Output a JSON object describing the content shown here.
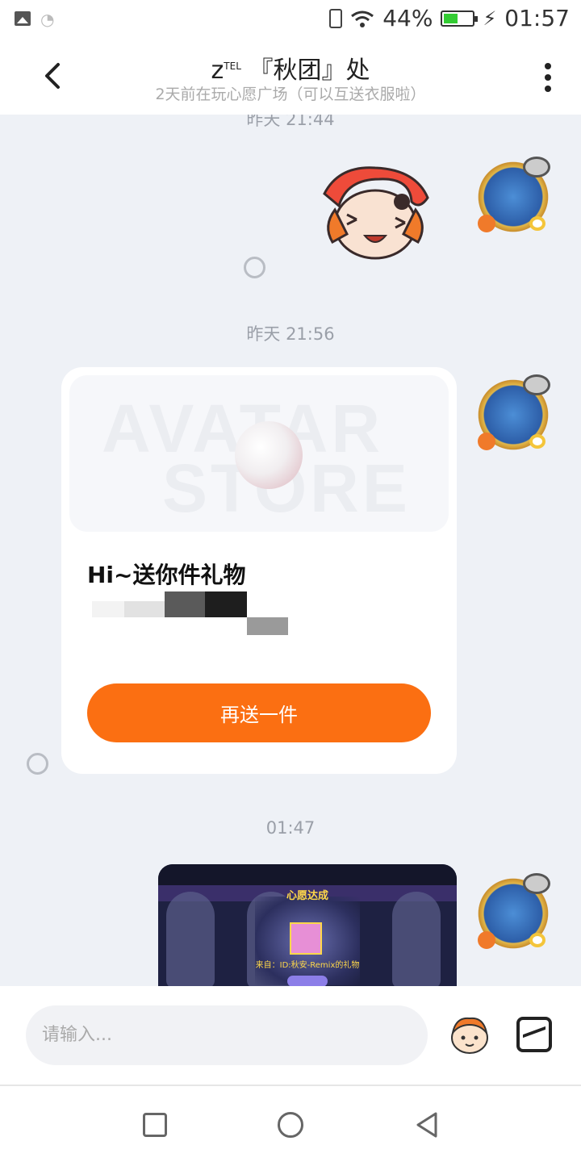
{
  "status_bar": {
    "battery": "44%",
    "battery_level": 0.44,
    "time": "01:57"
  },
  "header": {
    "title_prefix": "z",
    "title_sup": "TEL",
    "title_main": "『秋团』处",
    "subtitle": "2天前在玩心愿广场（可以互送衣服啦）"
  },
  "chat": {
    "timestamps": [
      "昨天 21:44",
      "昨天 21:56",
      "01:47"
    ],
    "gift_card": {
      "watermark_line1": "AVATAR",
      "watermark_line2": "STORE",
      "headline": "Hi~送你件礼物",
      "button_label": "再送一件"
    },
    "screenshot": {
      "wish_title": "心愿达成",
      "from_text": "来自：ID:秋安-Remix的礼物"
    }
  },
  "input_bar": {
    "placeholder": "请输入..."
  },
  "colors": {
    "accent": "#fb6f12",
    "background": "#eef1f6"
  }
}
